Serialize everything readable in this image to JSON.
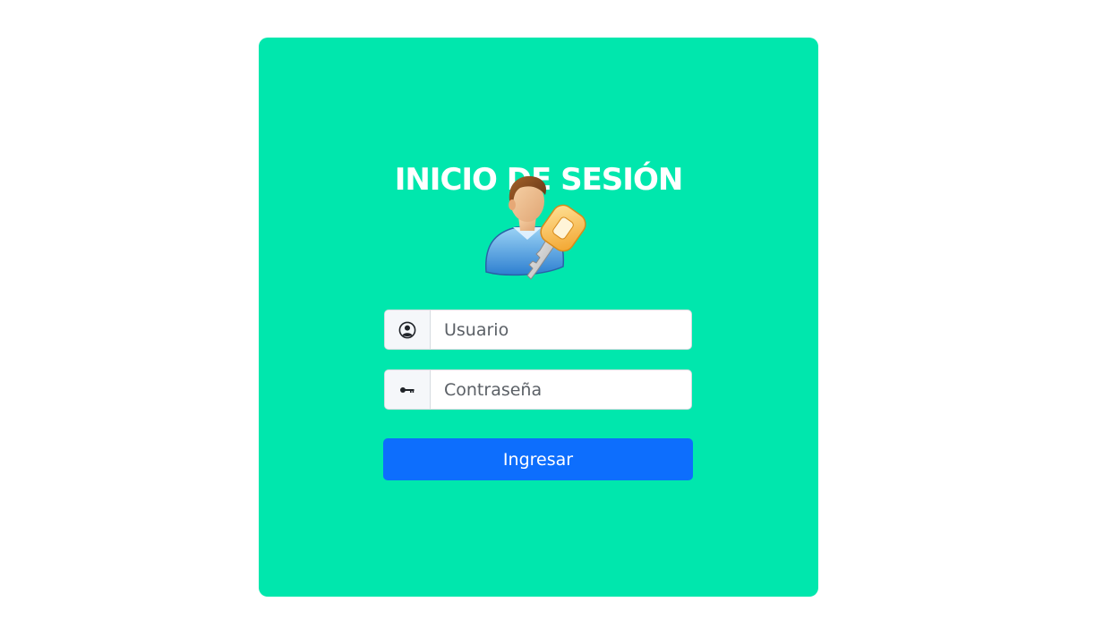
{
  "login": {
    "title": "INICIO DE SESIÓN",
    "avatar_icon": "user-key-icon",
    "username": {
      "icon": "user-circle-icon",
      "placeholder": "Usuario",
      "value": ""
    },
    "password": {
      "icon": "key-icon",
      "placeholder": "Contraseña",
      "value": ""
    },
    "submit_label": "Ingresar"
  },
  "colors": {
    "page_background": "#ffffff",
    "card_background": "#00e7ad",
    "button_primary": "#0d6efd",
    "title_text": "#ffffff"
  }
}
